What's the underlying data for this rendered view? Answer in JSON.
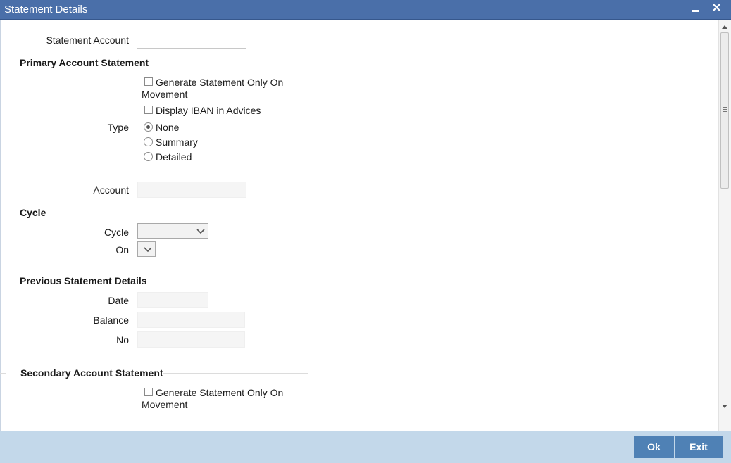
{
  "window": {
    "title": "Statement Details"
  },
  "statement_account": {
    "label": "Statement Account",
    "value": ""
  },
  "primary": {
    "heading": "Primary Account Statement",
    "gen_only_movement_line1": "Generate Statement Only On",
    "gen_only_movement_line2": "Movement",
    "display_iban": "Display IBAN in Advices",
    "type_label": "Type",
    "type_options": [
      "None",
      "Summary",
      "Detailed"
    ],
    "type_selected": "None",
    "account_label": "Account",
    "account_value": ""
  },
  "cycle": {
    "heading": "Cycle",
    "cycle_label": "Cycle",
    "cycle_value": "",
    "on_label": "On",
    "on_value": ""
  },
  "previous": {
    "heading": "Previous Statement Details",
    "date_label": "Date",
    "balance_label": "Balance",
    "no_label": "No"
  },
  "secondary": {
    "heading": "Secondary Account Statement",
    "gen_only_movement_line1": "Generate Statement Only On",
    "gen_only_movement_line2": "Movement"
  },
  "footer": {
    "ok_label": "Ok",
    "exit_label": "Exit"
  },
  "colors": {
    "titlebar": "#4a6fa9",
    "footer": "#c3d8ea",
    "button": "#4f81b5"
  }
}
